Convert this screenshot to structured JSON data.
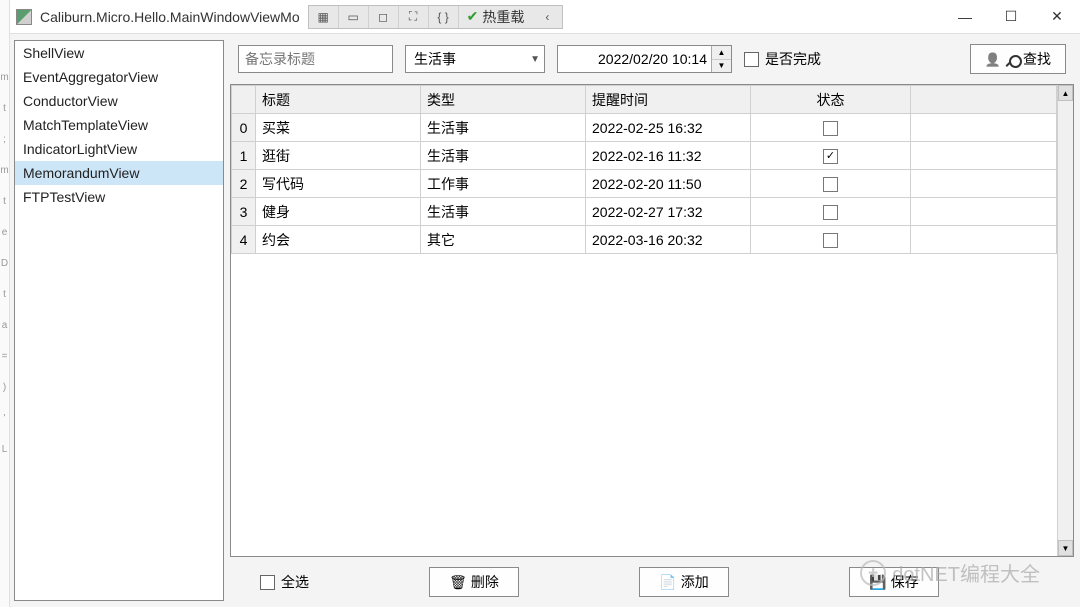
{
  "window": {
    "title": "Caliburn.Micro.Hello.MainWindowViewMo",
    "hot_reload": "热重载",
    "hot_reload_arrow": "‹"
  },
  "sidebar": {
    "items": [
      {
        "label": "ShellView",
        "selected": false
      },
      {
        "label": "EventAggregatorView",
        "selected": false
      },
      {
        "label": "ConductorView",
        "selected": false
      },
      {
        "label": "MatchTemplateView",
        "selected": false
      },
      {
        "label": "IndicatorLightView",
        "selected": false
      },
      {
        "label": "MemorandumView",
        "selected": true
      },
      {
        "label": "FTPTestView",
        "selected": false
      }
    ]
  },
  "filter": {
    "title_placeholder": "备忘录标题",
    "type_value": "生活事",
    "datetime_value": "2022/02/20 10:14",
    "done_label": "是否完成",
    "search_label": "查找"
  },
  "grid": {
    "headers": {
      "title": "标题",
      "type": "类型",
      "time": "提醒时间",
      "status": "状态"
    },
    "rows": [
      {
        "idx": "0",
        "title": "买菜",
        "type": "生活事",
        "time": "2022-02-25 16:32",
        "done": false
      },
      {
        "idx": "1",
        "title": "逛街",
        "type": "生活事",
        "time": "2022-02-16 11:32",
        "done": true
      },
      {
        "idx": "2",
        "title": "写代码",
        "type": "工作事",
        "time": "2022-02-20 11:50",
        "done": false
      },
      {
        "idx": "3",
        "title": "健身",
        "type": "生活事",
        "time": "2022-02-27 17:32",
        "done": false
      },
      {
        "idx": "4",
        "title": "约会",
        "type": "其它",
        "time": "2022-03-16 20:32",
        "done": false
      }
    ]
  },
  "bottom": {
    "select_all": "全选",
    "delete": "删除",
    "add": "添加",
    "save": "保存"
  },
  "watermark": "dotNET编程大全"
}
